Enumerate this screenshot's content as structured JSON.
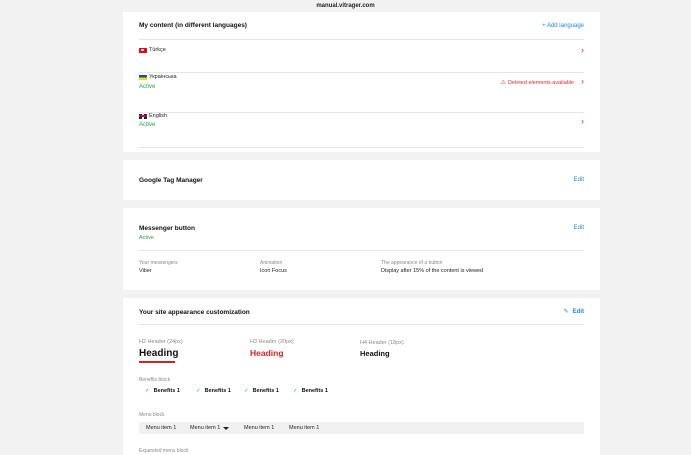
{
  "page": {
    "url": "manual.vitrager.com"
  },
  "content_card": {
    "title": "My content (in different languages)",
    "add_language": "+ Add language",
    "languages": [
      {
        "name": "Türkçe",
        "flag": "turkey-flag-icon",
        "status": ""
      },
      {
        "name": "Українська",
        "flag": "ukraine-flag-icon",
        "status": "Active",
        "warning": "Deleted elements available"
      },
      {
        "name": "English",
        "flag": "uk-flag-icon",
        "status": "Active"
      }
    ]
  },
  "gtm_card": {
    "title": "Google Tag Manager",
    "edit": "Edit"
  },
  "messenger_card": {
    "title": "Messenger button",
    "status": "Active",
    "edit": "Edit",
    "fields": [
      {
        "label": "Your messengers",
        "value": "Viber"
      },
      {
        "label": "Animation",
        "value": "Icon Focus"
      },
      {
        "label": "The appearance of a button",
        "value": "Display after 15% of the content is viewed"
      }
    ]
  },
  "appearance_card": {
    "title": "Your site appearance customization",
    "edit": "Edit",
    "headers": [
      {
        "label": "H2 Header (24px)",
        "sample": "Heading"
      },
      {
        "label": "H3 Header (20px)",
        "sample": "Heading"
      },
      {
        "label": "H4 Header (18px)",
        "sample": "Heading"
      }
    ],
    "benefits_label": "Benefits block",
    "benefits": [
      "Benefits 1",
      "Benefits 1",
      "Benefits 1",
      "Benefits 1"
    ],
    "menu_label": "Menu block",
    "menu_items": [
      "Menu item 1",
      "Menu item 1",
      "Menu item 1",
      "Menu item 1"
    ],
    "expanded_menu_label": "Expanded menu block"
  },
  "colors": {
    "accent": "#1e88e5",
    "danger": "#d32f2f",
    "success": "#2e9e4d",
    "heading_red": "#c62828"
  }
}
